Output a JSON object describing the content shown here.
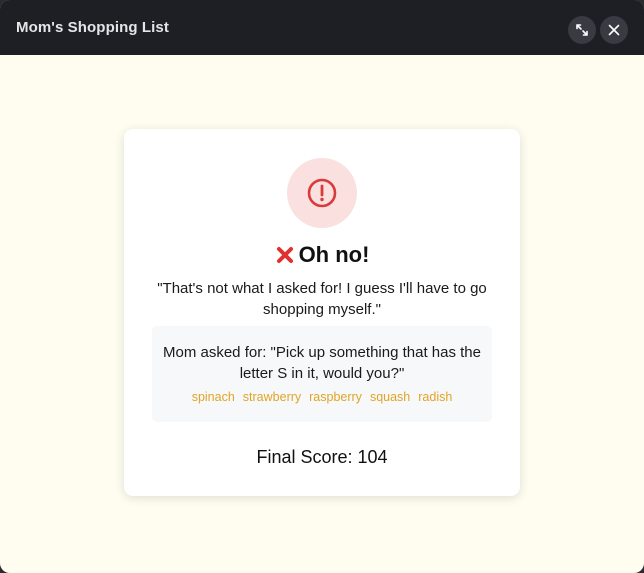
{
  "window": {
    "title": "Mom's Shopping List"
  },
  "result": {
    "icon": "alert-circle-icon",
    "heading_icon": "red-x-icon",
    "heading": "Oh no!",
    "message": "\"That's not what I asked for! I guess I'll have to go shopping myself.\"",
    "request": "Mom asked for: \"Pick up something that has the letter S in it, would you?\"",
    "examples": [
      "spinach",
      "strawberry",
      "raspberry",
      "squash",
      "radish"
    ],
    "score_text": "Final Score: 104"
  },
  "colors": {
    "titlebar": "#1d1f24",
    "background": "#fefdf0",
    "alert_red": "#d93a3a",
    "alert_bg": "#fbe0e0",
    "example_text": "#e0a527"
  }
}
